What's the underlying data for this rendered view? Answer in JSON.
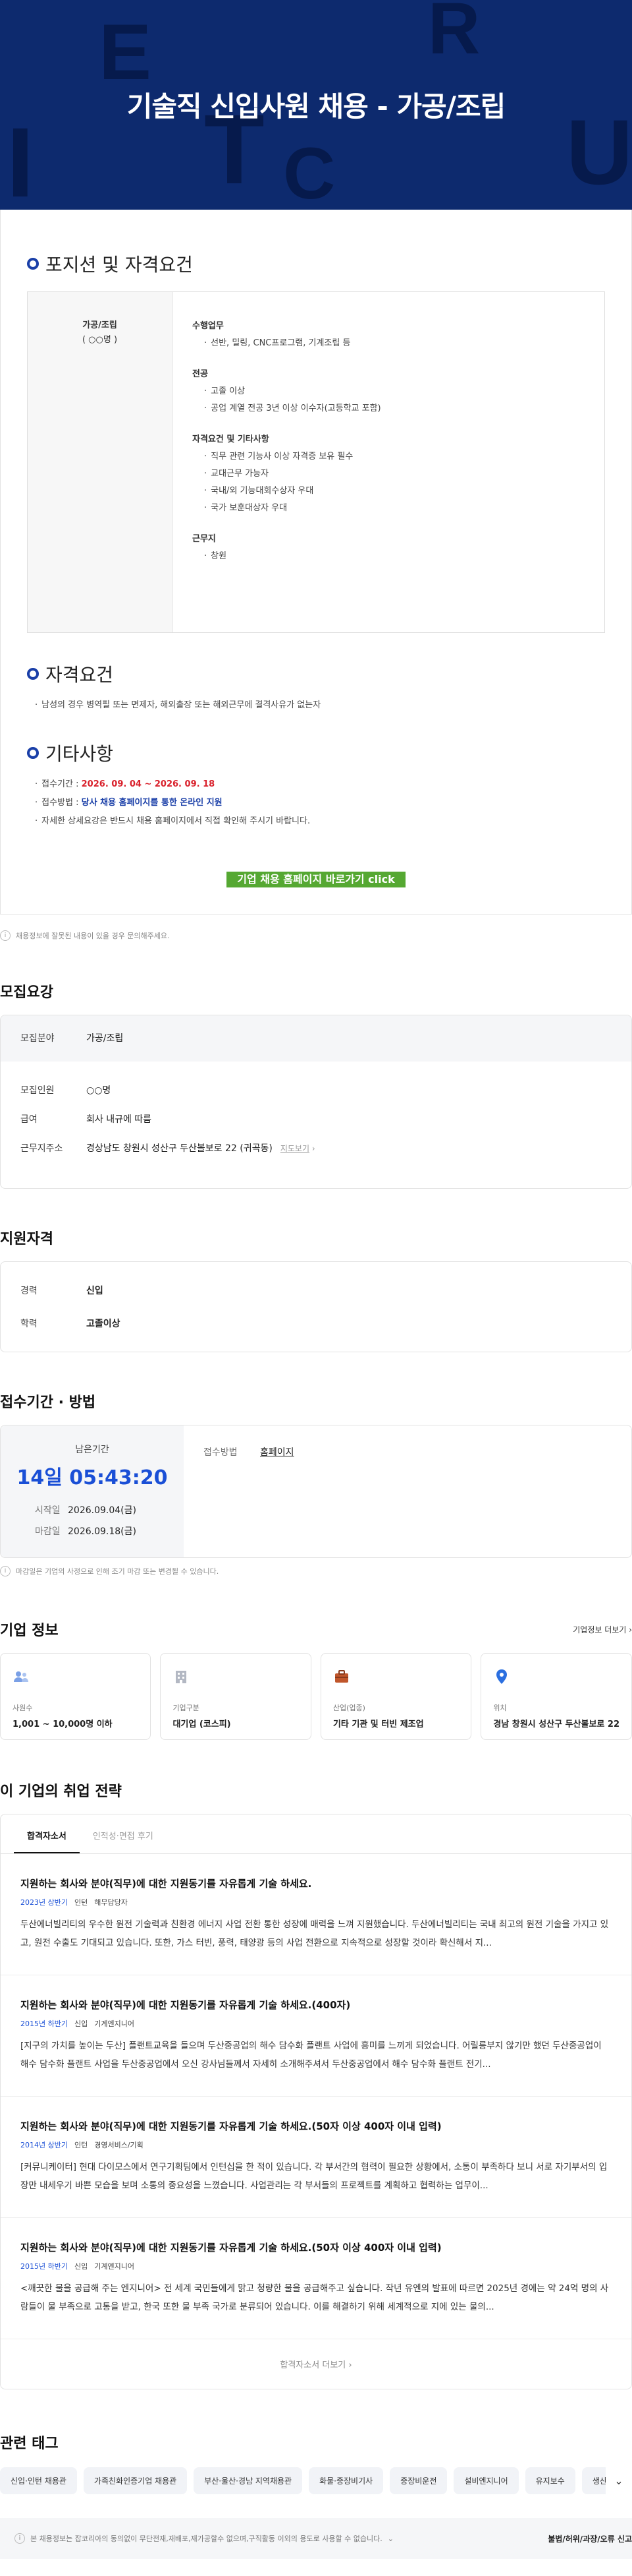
{
  "hero": {
    "title": "기술직 신입사원 채용 - 가공/조립",
    "deco_letters": [
      "E",
      "R",
      "C",
      "U",
      "I",
      "T"
    ]
  },
  "position": {
    "heading": "포지션 및 자격요건",
    "left": {
      "name": "가공/조립",
      "count": "( ○○명 )"
    },
    "groups": [
      {
        "title": "수행업무",
        "items": [
          "선반, 밀링, CNC프로그램, 기계조립 등"
        ]
      },
      {
        "title": "전공",
        "items": [
          "고졸 이상",
          "공업 계열 전공 3년 이상 이수자(고등학교 포함)"
        ]
      },
      {
        "title": "자격요건 및 기타사항",
        "items": [
          "직무 관련 기능사 이상 자격증 보유 필수",
          "교대근무 가능자",
          "국내/외 기능대회수상자 우대",
          "국가 보훈대상자 우대"
        ]
      },
      {
        "title": "근무지",
        "items": [
          "창원"
        ]
      }
    ]
  },
  "qualify": {
    "heading": "자격요건",
    "items": [
      "남성의 경우 병역필 또는 면제자, 해외출장 또는 해외근무에 결격사유가 없는자"
    ]
  },
  "etc": {
    "heading": "기타사항",
    "period_label": "접수기간 : ",
    "period_value": "2026. 09. 04 ~ 2026. 09. 18",
    "method_label": "접수방법 : ",
    "method_value": "당사 채용 홈페이지를 통한 온라인 지원",
    "note": "자세한 상세요강은 반드시 채용 홈페이지에서 직접 확인해 주시기 바랍니다.",
    "button": "기업 채용 홈페이지 바로가기 click"
  },
  "notice1": "채용정보에 잘못된 내용이 있을 경우 문의해주세요.",
  "recruit": {
    "heading": "모집요강",
    "rows": [
      {
        "k": "모집분야",
        "v": "가공/조립"
      },
      {
        "k": "모집인원",
        "v": "○○명"
      },
      {
        "k": "급여",
        "v": "회사 내규에 따름"
      },
      {
        "k": "근무지주소",
        "v": "경상남도 창원시 성산구 두산볼보로 22 (귀곡동)",
        "link": "지도보기"
      }
    ]
  },
  "support": {
    "heading": "지원자격",
    "rows": [
      {
        "k": "경력",
        "v": "신입"
      },
      {
        "k": "학력",
        "v": "고졸이상"
      }
    ]
  },
  "deadline": {
    "heading": "접수기간 · 방법",
    "remain_label": "남은기간",
    "remain": "14일 05:43:20",
    "start_label": "시작일",
    "start": "2026.09.04(금)",
    "end_label": "마감일",
    "end": "2026.09.18(금)",
    "method_label": "접수방법",
    "method": "홈페이지"
  },
  "notice2": "마감일은 기업의 사정으로 인해 조기 마감 또는 변경될 수 있습니다.",
  "company": {
    "heading": "기업 정보",
    "more": "기업정보 더보기",
    "cards": [
      {
        "icon": "people-icon",
        "label": "사원수",
        "value": "1,001 ~ 10,000명 이하"
      },
      {
        "icon": "building-icon",
        "label": "기업구분",
        "value": "대기업 (코스피)"
      },
      {
        "icon": "briefcase-icon",
        "label": "산업(업종)",
        "value": "기타 기관 및 터빈 제조업"
      },
      {
        "icon": "location-pin-icon",
        "label": "위치",
        "value": "경남 창원시 성산구 두산볼보로 22"
      }
    ]
  },
  "strategy": {
    "heading": "이 기업의 취업 전략",
    "tabs": [
      "합격자소서",
      "인적성·면접 후기"
    ],
    "articles": [
      {
        "q": "지원하는 회사와 분야(직무)에 대한 지원동기를 자유롭게 기술 하세요.",
        "year": "2023년 상반기",
        "type": "인턴",
        "job": "해무담당자",
        "body": "두산에너빌리티의 우수한 원전 기술력과 친환경 에너지 사업 전환 통한 성장에 매력을 느껴 지원했습니다. 두산에너빌리티는 국내 최고의 원전 기술을 가지고 있고, 원전 수출도 기대되고 있습니다. 또한, 가스 터빈, 풍력, 태양광 등의 사업 전환으로 지속적으로 성장할 것이라 확신해서 지..."
      },
      {
        "q": "지원하는 회사와 분야(직무)에 대한 지원동기를 자유롭게 기술 하세요.(400자)",
        "year": "2015년 하반기",
        "type": "신입",
        "job": "기계엔지니어",
        "body": "[지구의 가치를 높이는 두산] 플랜트교육을 들으며 두산중공업의 해수 담수화 플랜트 사업에 흥미를 느끼게 되었습니다. 어릴릉부지 않기만 했던 두산중공업이 해수 담수화 플랜트 사업을 두산중공업에서 오신 강사님들께서 자세히 소개해주셔서 두산중공업에서 해수 담수화 플랜트 전기..."
      },
      {
        "q": "지원하는 회사와 분야(직무)에 대한 지원동기를 자유롭게 기술 하세요.(50자 이상 400자 이내 입력)",
        "year": "2014년 상반기",
        "type": "인턴",
        "job": "경영서비스/기획",
        "body": "[커뮤니케이터] 현대 다이모스에서 연구기획팀에서 인턴십을 한 적이 있습니다. 각 부서간의 협력이 필요한 상황에서, 소통이 부족하다 보니 서로 자기부서의 입장만 내세우기 바쁜 모습을 보며 소통의 중요성을 느꼈습니다. 사업관리는 각 부서들의 프로젝트를 계획하고 협력하는 업무이..."
      },
      {
        "q": "지원하는 회사와 분야(직무)에 대한 지원동기를 자유롭게 기술 하세요.(50자 이상 400자 이내 입력)",
        "year": "2015년 하반기",
        "type": "신입",
        "job": "기계엔지니어",
        "body": "<깨끗한 물을 공급해 주는 엔지니어> 전 세계 국민들에게 맑고 청량한 물을 공급해주고 싶습니다. 작년 유엔의 발표에 따르면 2025년 경에는 약 24억 명의 사람들이 물 부족으로 고통을 받고, 한국 또한 물 부족 국가로 분류되어 있습니다. 이를 해결하기 위해 세계적으로 지에 있는 물의..."
      }
    ],
    "more": "합격자소서 더보기"
  },
  "tags": {
    "heading": "관련 태그",
    "items": [
      "신입·인턴 채용관",
      "가족친화인증기업 채용관",
      "부산·울산·경남 지역채용관",
      "화물·중장비기사",
      "중장비운전",
      "설비엔지니어",
      "유지보수",
      "생산기술"
    ]
  },
  "footer": {
    "text": "본 채용정보는 잡코리아의 동의없이 무단전재,재배포,재가공할수 없으며,구직활동 이외의 용도로 사용할 수 없습니다.",
    "report": "불법/허위/과장/오류 신고"
  }
}
